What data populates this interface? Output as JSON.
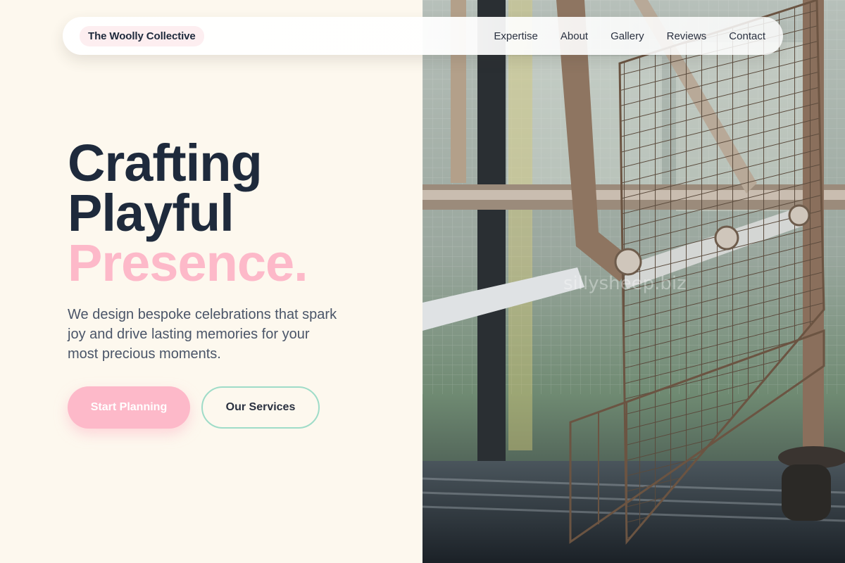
{
  "brand": {
    "name": "The Woolly Collective"
  },
  "nav": {
    "links": [
      {
        "label": "Expertise"
      },
      {
        "label": "About"
      },
      {
        "label": "Gallery"
      },
      {
        "label": "Reviews"
      },
      {
        "label": "Contact"
      }
    ]
  },
  "hero": {
    "headline_line1": "Crafting",
    "headline_line2": "Playful",
    "headline_accent": "Presence.",
    "subtext": "We design bespoke celebrations that spark joy and drive lasting memories for your most precious moments.",
    "primary_cta": "Start Planning",
    "secondary_cta": "Our Services"
  },
  "image": {
    "watermark": "sillysheep.biz"
  },
  "colors": {
    "background": "#fdf8ee",
    "heading": "#1e2a3c",
    "accent_pink": "#fdb9c9",
    "accent_mint": "#9fdcc8",
    "brand_badge": "#fdeef0"
  }
}
